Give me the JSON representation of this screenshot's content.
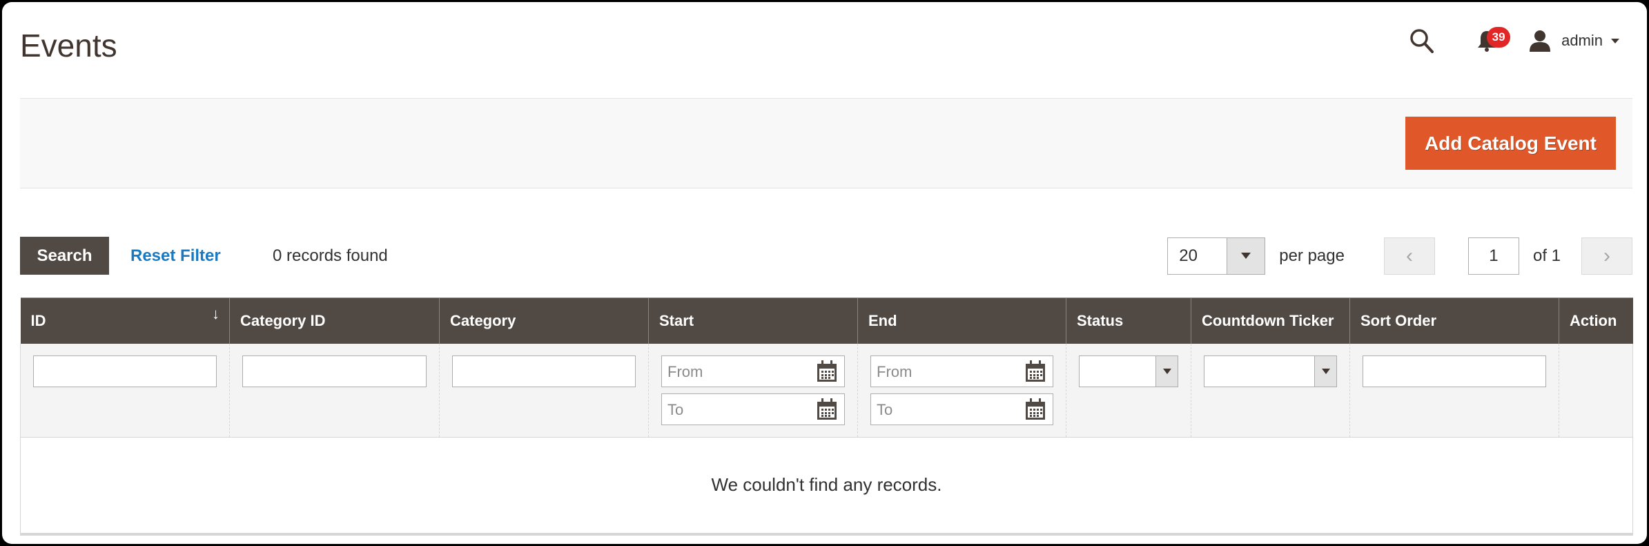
{
  "header": {
    "title": "Events",
    "notifications_count": "39",
    "user_name": "admin"
  },
  "actions": {
    "add_label": "Add Catalog Event"
  },
  "toolbar": {
    "search_label": "Search",
    "reset_label": "Reset Filter",
    "records_text": "0 records found",
    "per_page_value": "20",
    "per_page_label": "per page",
    "current_page": "1",
    "page_of": "of 1",
    "prev_glyph": "‹",
    "next_glyph": "›"
  },
  "grid": {
    "columns": [
      {
        "label": "ID",
        "sort_glyph": "↓"
      },
      {
        "label": "Category ID"
      },
      {
        "label": "Category"
      },
      {
        "label": "Start"
      },
      {
        "label": "End"
      },
      {
        "label": "Status"
      },
      {
        "label": "Countdown Ticker"
      },
      {
        "label": "Sort Order"
      },
      {
        "label": "Action"
      }
    ],
    "filters": {
      "date_from_placeholder": "From",
      "date_to_placeholder": "To"
    },
    "empty_message": "We couldn't find any records."
  },
  "colors": {
    "accent": "#e0582a",
    "header_bg": "#514943",
    "link": "#1979c3",
    "badge": "#e22626"
  }
}
